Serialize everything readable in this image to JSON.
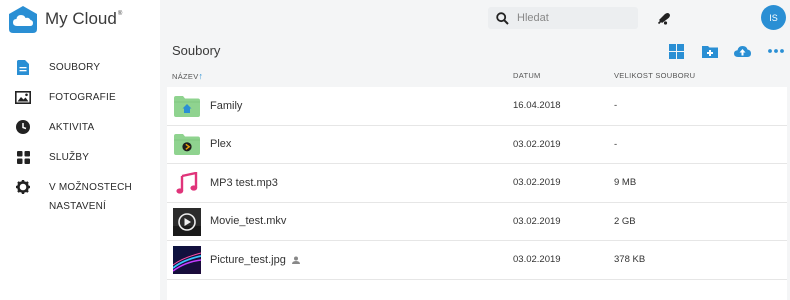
{
  "app": {
    "name": "My Cloud",
    "trademark": "®"
  },
  "sidebar": {
    "items": [
      {
        "label": "SOUBORY",
        "icon": "file-icon"
      },
      {
        "label": "FOTOGRAFIE",
        "icon": "image-icon"
      },
      {
        "label": "AKTIVITA",
        "icon": "clock-icon"
      },
      {
        "label": "SLUŽBY",
        "icon": "apps-grid-icon"
      },
      {
        "label": "V MOŽNOSTECH",
        "icon": "gear-icon"
      }
    ],
    "extra": "NASTAVENÍ"
  },
  "header": {
    "search_placeholder": "Hledat",
    "user_initials": "IS"
  },
  "main": {
    "title": "Soubory",
    "columns": {
      "name": "NÁZEV",
      "date": "DATUM",
      "size": "VELIKOST SOUBORU"
    },
    "sort_indicator": "↑",
    "files": [
      {
        "name": "Family",
        "date": "16.04.2018",
        "size": "-",
        "type": "folder-home"
      },
      {
        "name": "Plex",
        "date": "03.02.2019",
        "size": "-",
        "type": "folder-plex"
      },
      {
        "name": "MP3 test.mp3",
        "date": "03.02.2019",
        "size": "9 MB",
        "type": "audio"
      },
      {
        "name": "Movie_test.mkv",
        "date": "03.02.2019",
        "size": "2 GB",
        "type": "video"
      },
      {
        "name": "Picture_test.jpg",
        "date": "03.02.2019",
        "size": "378 KB",
        "type": "image",
        "shared": true
      }
    ]
  },
  "colors": {
    "accent": "#2a8fd4",
    "folder": "#8fd38f",
    "music": "#e0347a"
  }
}
